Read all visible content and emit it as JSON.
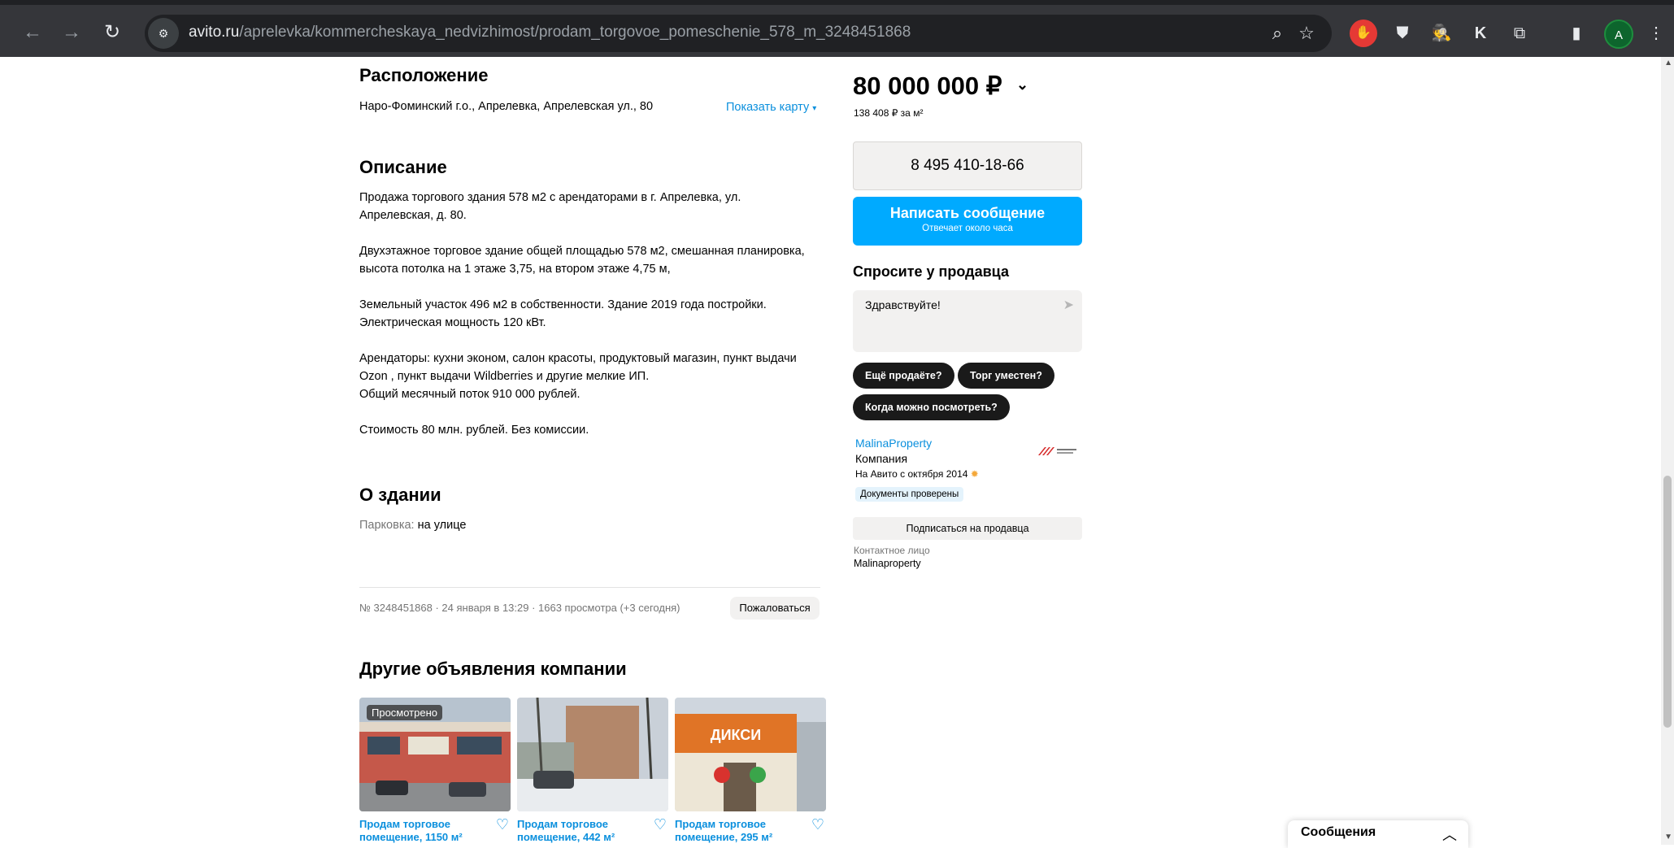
{
  "browser": {
    "url_host": "avito.ru",
    "url_path": "/aprelevka/kommercheskaya_nedvizhimost/prodam_torgovoe_pomeschenie_578_m_3248451868",
    "avatar_letter": "A",
    "ext_k": "K"
  },
  "location": {
    "title": "Расположение",
    "address": "Наро-Фоминский г.о., Апрелевка, Апрелевская ул., 80",
    "show_map": "Показать карту"
  },
  "description": {
    "title": "Описание",
    "lines": [
      "Продажа торгового здания 578 м2 с арендаторами в г. Апрелевка, ул.",
      "Апрелевская, д. 80.",
      "",
      "Двухэтажное торговое здание общей площадью 578 м2, смешанная планировка,",
      "высота потолка на 1 этаже 3,75, на втором этаже 4,75 м,",
      "",
      "Земельный участок 496 м2 в собственности. Здание 2019 года постройки.",
      "Электрическая мощность 120 кВт.",
      "",
      "Арендаторы: кухни эконом, салон красоты, продуктовый магазин, пункт выдачи",
      "Ozon , пункт выдачи Wildberries и другие мелкие ИП.",
      "Общий месячный поток 910 000 рублей.",
      "",
      "Стоимость 80 млн. рублей. Без комиссии."
    ]
  },
  "building": {
    "title": "О здании",
    "parking_label": "Парковка:",
    "parking_value": "на улице"
  },
  "meta": {
    "info": "№ 3248451868 · 24 января в 13:29 · 1663 просмотра (+3 сегодня)",
    "complain": "Пожаловаться"
  },
  "other_ads": {
    "title": "Другие объявления компании",
    "viewed_badge": "Просмотрено",
    "cards": [
      {
        "title": "Продам торговое помещение, 1150 м²"
      },
      {
        "title": "Продам торговое помещение, 442 м²"
      },
      {
        "title": "Продам торговое помещение, 295 м²"
      }
    ],
    "sign_text": "ДИКСИ"
  },
  "sidebar": {
    "price": "80 000 000 ₽",
    "price_per_sq": "138 408 ₽ за м²",
    "phone": "8 495 410-18-66",
    "message_btn": "Написать сообщение",
    "message_sub": "Отвечает около часа",
    "ask_title": "Спросите у продавца",
    "ask_value": "Здравствуйте!",
    "chips": [
      "Ещё продаёте?",
      "Торг уместен?",
      "Когда можно посмотреть?"
    ],
    "seller_name": "MalinaProperty",
    "seller_type": "Компания",
    "seller_since": "На Авито с октября 2014",
    "verified": "Документы проверены",
    "subscribe": "Подписаться на продавца",
    "contact_label": "Контактное лицо",
    "contact_name": "Malinaproperty"
  },
  "messages_widget": {
    "label": "Сообщения"
  },
  "colors": {
    "accent_blue": "#00aaff",
    "link_blue": "#0a8fdd"
  }
}
